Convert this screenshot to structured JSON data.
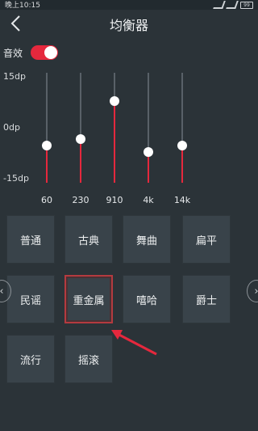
{
  "status": {
    "time": "晚上10:15",
    "battery": "99"
  },
  "header": {
    "title": "均衡器"
  },
  "sound_effect": {
    "label": "音效",
    "enabled": true
  },
  "eq": {
    "db_labels": {
      "max": "15dp",
      "mid": "0dp",
      "min": "-15dp"
    },
    "bands": [
      {
        "freq": "60",
        "level": 0.34
      },
      {
        "freq": "230",
        "level": 0.4
      },
      {
        "freq": "910",
        "level": 0.74
      },
      {
        "freq": "4k",
        "level": 0.28
      },
      {
        "freq": "14k",
        "level": 0.34
      }
    ]
  },
  "presets": [
    {
      "label": "普通"
    },
    {
      "label": "古典"
    },
    {
      "label": "舞曲"
    },
    {
      "label": "扁平"
    },
    {
      "label": "民谣"
    },
    {
      "label": "重金属",
      "selected": true
    },
    {
      "label": "嘻哈"
    },
    {
      "label": "爵士"
    },
    {
      "label": "流行"
    },
    {
      "label": "摇滚"
    }
  ],
  "nav": {
    "prev": "‹",
    "next": "›"
  },
  "colors": {
    "accent": "#e5283d",
    "background": "#2b3338",
    "tile": "#39434a"
  }
}
